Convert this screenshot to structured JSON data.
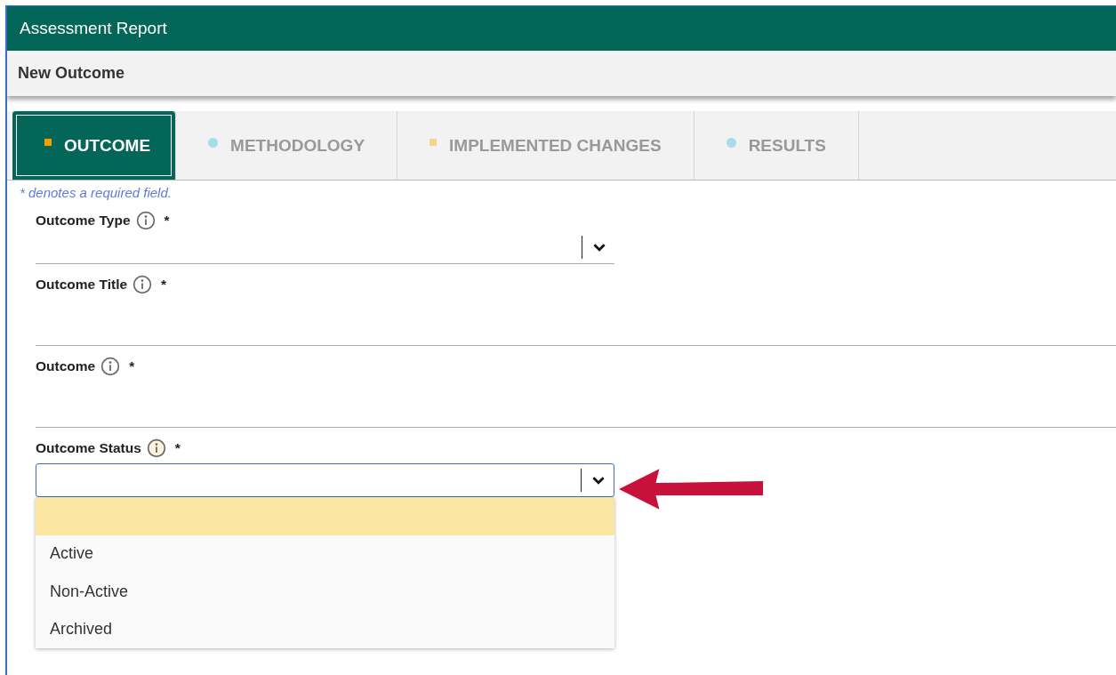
{
  "window": {
    "title": "Assessment Report"
  },
  "subheader": {
    "title": "New Outcome"
  },
  "tabs": [
    {
      "label": "OUTCOME",
      "selected": true,
      "kind": "square",
      "color": "#f5a000"
    },
    {
      "label": "METHODOLOGY",
      "selected": false,
      "kind": "dot",
      "color": "#a8dce8"
    },
    {
      "label": "IMPLEMENTED CHANGES",
      "selected": false,
      "kind": "square",
      "color": "#f7d58c"
    },
    {
      "label": "RESULTS",
      "selected": false,
      "kind": "dot",
      "color": "#a8dce8"
    }
  ],
  "required_note": "* denotes a required field.",
  "fields": [
    {
      "label": "Outcome Type",
      "required": "*",
      "kind": "select",
      "expanded": false
    },
    {
      "label": "Outcome Title",
      "required": "*",
      "kind": "text"
    },
    {
      "label": "Outcome",
      "required": "*",
      "kind": "text"
    },
    {
      "label": "Outcome Status",
      "required": "*",
      "kind": "select",
      "expanded": true,
      "options": [
        {
          "highlighted": true
        },
        {
          "label": "Active",
          "highlighted": false
        },
        {
          "label": "Non-Active",
          "highlighted": false
        },
        {
          "label": "Archived",
          "highlighted": false
        }
      ]
    }
  ]
}
